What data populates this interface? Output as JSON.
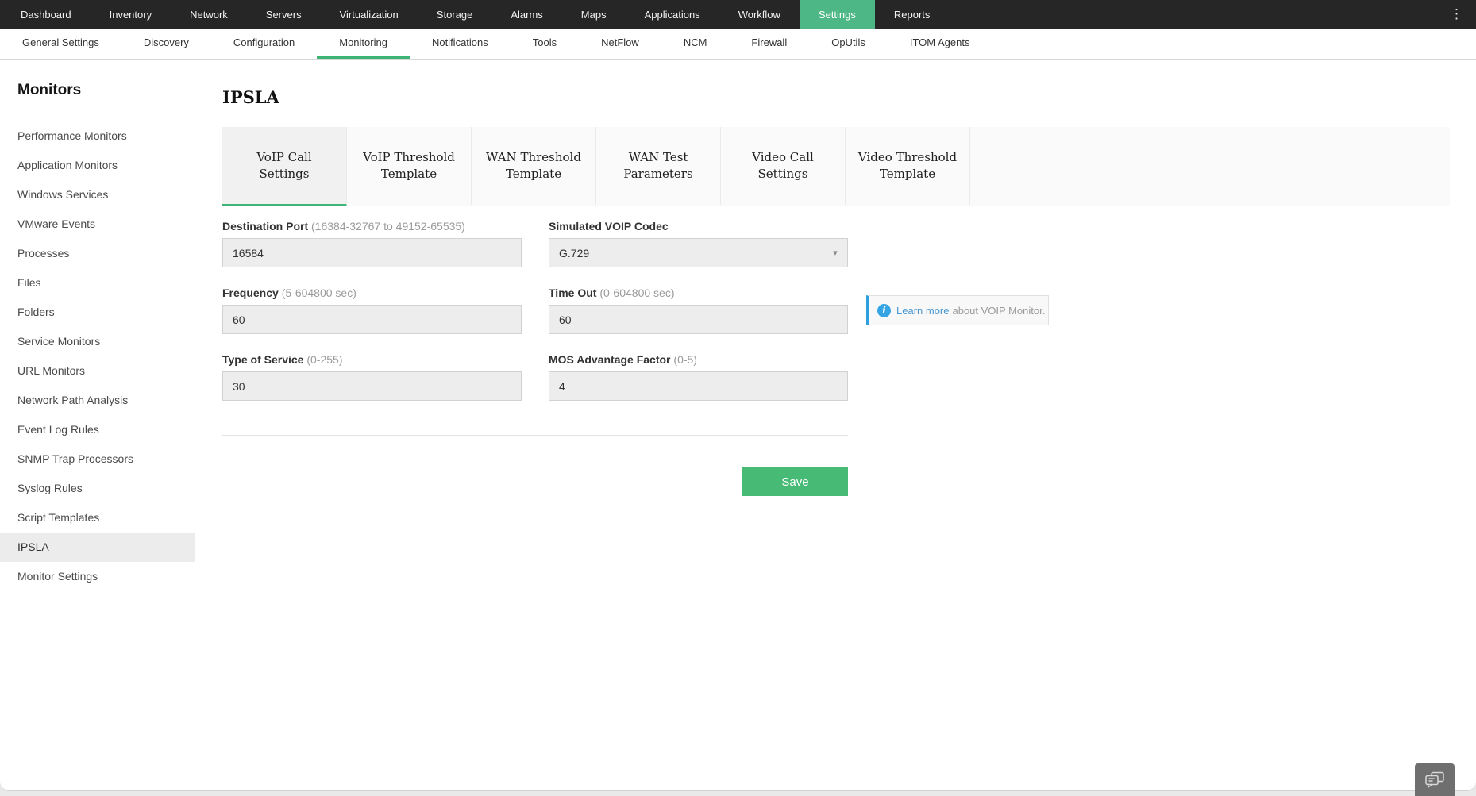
{
  "topnav": {
    "items": [
      {
        "label": "Dashboard"
      },
      {
        "label": "Inventory"
      },
      {
        "label": "Network"
      },
      {
        "label": "Servers"
      },
      {
        "label": "Virtualization"
      },
      {
        "label": "Storage"
      },
      {
        "label": "Alarms"
      },
      {
        "label": "Maps"
      },
      {
        "label": "Applications"
      },
      {
        "label": "Workflow"
      },
      {
        "label": "Settings",
        "active": true
      },
      {
        "label": "Reports"
      }
    ]
  },
  "subnav": {
    "items": [
      {
        "label": "General Settings"
      },
      {
        "label": "Discovery"
      },
      {
        "label": "Configuration"
      },
      {
        "label": "Monitoring",
        "active": true
      },
      {
        "label": "Notifications"
      },
      {
        "label": "Tools"
      },
      {
        "label": "NetFlow"
      },
      {
        "label": "NCM"
      },
      {
        "label": "Firewall"
      },
      {
        "label": "OpUtils"
      },
      {
        "label": "ITOM Agents"
      }
    ]
  },
  "sidebar": {
    "title": "Monitors",
    "items": [
      {
        "label": "Performance Monitors"
      },
      {
        "label": "Application Monitors"
      },
      {
        "label": "Windows Services"
      },
      {
        "label": "VMware Events"
      },
      {
        "label": "Processes"
      },
      {
        "label": "Files"
      },
      {
        "label": "Folders"
      },
      {
        "label": "Service Monitors"
      },
      {
        "label": "URL Monitors"
      },
      {
        "label": "Network Path Analysis"
      },
      {
        "label": "Event Log Rules"
      },
      {
        "label": "SNMP Trap Processors"
      },
      {
        "label": "Syslog Rules"
      },
      {
        "label": "Script Templates"
      },
      {
        "label": "IPSLA",
        "selected": true
      },
      {
        "label": "Monitor Settings"
      }
    ]
  },
  "main": {
    "title": "IPSLA",
    "tabs": [
      {
        "label": "VoIP Call Settings",
        "active": true
      },
      {
        "label": "VoIP Threshold Template"
      },
      {
        "label": "WAN Threshold Template"
      },
      {
        "label": "WAN Test Parameters"
      },
      {
        "label": "Video Call Settings"
      },
      {
        "label": "Video Threshold Template"
      }
    ],
    "form": {
      "fields": [
        {
          "label": "Destination Port",
          "hint": "(16384-32767 to 49152-65535)",
          "value": "16584",
          "type": "text"
        },
        {
          "label": "Simulated VOIP Codec",
          "hint": "",
          "value": "G.729",
          "type": "select"
        },
        {
          "label": "Frequency",
          "hint": "(5-604800 sec)",
          "value": "60",
          "type": "text"
        },
        {
          "label": "Time Out",
          "hint": "(0-604800 sec)",
          "value": "60",
          "type": "text"
        },
        {
          "label": "Type of Service",
          "hint": "(0-255)",
          "value": "30",
          "type": "text"
        },
        {
          "label": "MOS Advantage Factor",
          "hint": "(0-5)",
          "value": "4",
          "type": "text"
        }
      ],
      "save_label": "Save"
    },
    "info": {
      "link_text": "Learn more",
      "text": "about VOIP Monitor."
    }
  },
  "icons": {
    "kebab": "⋮",
    "dropdown_arrow": "▾",
    "info": "i"
  },
  "colors": {
    "accent_green": "#3eb576",
    "settings_tab_green": "#4db886",
    "save_green": "#47ba76",
    "nav_bg": "#262626",
    "info_blue": "#35a4e4",
    "link_blue": "#4a97d2"
  }
}
